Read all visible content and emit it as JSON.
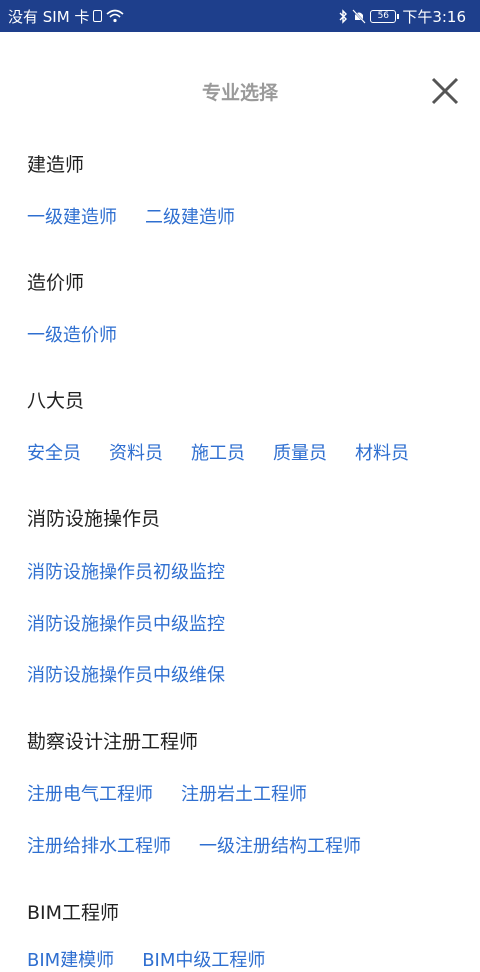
{
  "status_bar": {
    "carrier": "没有 SIM 卡",
    "battery": "56",
    "time": "下午3:16"
  },
  "header": {
    "title": "专业选择"
  },
  "sections": [
    {
      "title": "建造师",
      "rows": [
        [
          "一级建造师",
          "二级建造师"
        ]
      ]
    },
    {
      "title": "造价师",
      "rows": [
        [
          "一级造价师"
        ]
      ]
    },
    {
      "title": "八大员",
      "rows": [
        [
          "安全员",
          "资料员",
          "施工员",
          "质量员",
          "材料员"
        ]
      ]
    },
    {
      "title": "消防设施操作员",
      "rows": [
        [
          "消防设施操作员初级监控"
        ],
        [
          "消防设施操作员中级监控"
        ],
        [
          "消防设施操作员中级维保"
        ]
      ]
    },
    {
      "title": "勘察设计注册工程师",
      "rows": [
        [
          "注册电气工程师",
          "注册岩土工程师"
        ],
        [
          "注册给排水工程师",
          "一级注册结构工程师"
        ]
      ]
    },
    {
      "title": "BIM工程师",
      "rows": [
        [
          "BIM建模师",
          "BIM中级工程师"
        ]
      ]
    }
  ],
  "colors": {
    "status_bar_bg": "#1e3f8c",
    "link": "#2f6fd0",
    "title": "#9a9a9a"
  }
}
